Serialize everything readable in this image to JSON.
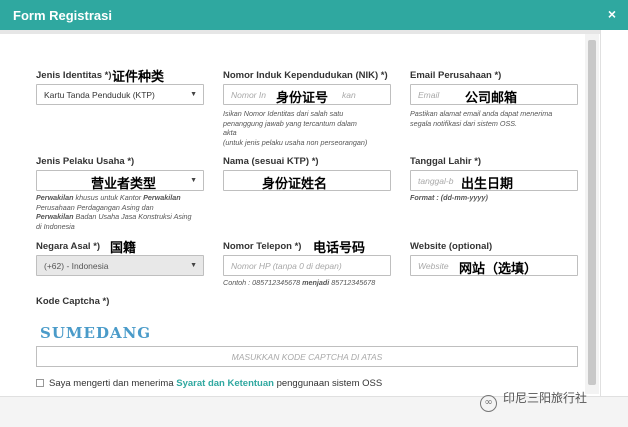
{
  "window": {
    "title": "Form Registrasi",
    "close_glyph": "×"
  },
  "fields": {
    "jenis_identitas": {
      "label": "Jenis Identitas *)",
      "annotation": "证件种类",
      "value": "Kartu Tanda Penduduk (KTP)"
    },
    "nik": {
      "label": "Nomor Induk Kependudukan (NIK) *)",
      "placeholder_left": "Nomor In",
      "placeholder_right": "kan",
      "annotation": "身份证号",
      "help": [
        "Isikan Nomor Identitas dari salah satu",
        "penanggung jawab yang tercantum dalam",
        "akta",
        "(untuk jenis pelaku usaha non perseorangan)"
      ]
    },
    "email": {
      "label": "Email Perusahaan *)",
      "placeholder": "Email",
      "annotation": "公司邮箱",
      "help": [
        "Pastikan alamat email anda dapat menerima",
        "segala notifikasi dari sistem OSS."
      ]
    },
    "jenis_pelaku": {
      "label": "Jenis Pelaku Usaha *)",
      "annotation": "营业者类型",
      "help_lines": [
        {
          "bold": "Perwakilan",
          "text": " khusus untuk Kantor ",
          "bold2": "Perwakilan"
        },
        {
          "text": "Perusahaan Perdagangan Asing dan"
        },
        {
          "bold": "Perwakilan",
          "text": " Badan Usaha Jasa Konstruksi Asing"
        },
        {
          "text": "di Indonesia"
        }
      ]
    },
    "nama": {
      "label": "Nama (sesuai KTP) *)",
      "annotation": "身份证姓名"
    },
    "tanggal_lahir": {
      "label": "Tanggal Lahir *)",
      "placeholder": "tanggal-b",
      "annotation": "出生日期",
      "help": "Format : (dd-mm-yyyy)"
    },
    "negara_asal": {
      "label": "Negara Asal *)",
      "annotation": "国籍",
      "value": "(+62) - Indonesia"
    },
    "telepon": {
      "label": "Nomor Telepon *)",
      "placeholder": "Nomor HP (tanpa 0 di depan)",
      "annotation": "电话号码",
      "help_prefix": "Contoh : 085712345678 ",
      "help_bold": "menjadi",
      "help_suffix": " 85712345678"
    },
    "website": {
      "label": "Website (optional)",
      "placeholder": "Website",
      "annotation": "网站（选填）"
    }
  },
  "captcha": {
    "label": "Kode Captcha *)",
    "image_text": "SUMEDANG",
    "placeholder": "MASUKKAN KODE CAPTCHA DI ATAS"
  },
  "agreement": {
    "prefix": "Saya mengerti dan menerima ",
    "link": "Syarat dan Ketentuan",
    "suffix": " penggunaan sistem OSS"
  },
  "watermark": {
    "icon": "wechat-icon",
    "text": "印尼三阳旅行社"
  },
  "colors": {
    "accent": "#2fa8a0"
  }
}
